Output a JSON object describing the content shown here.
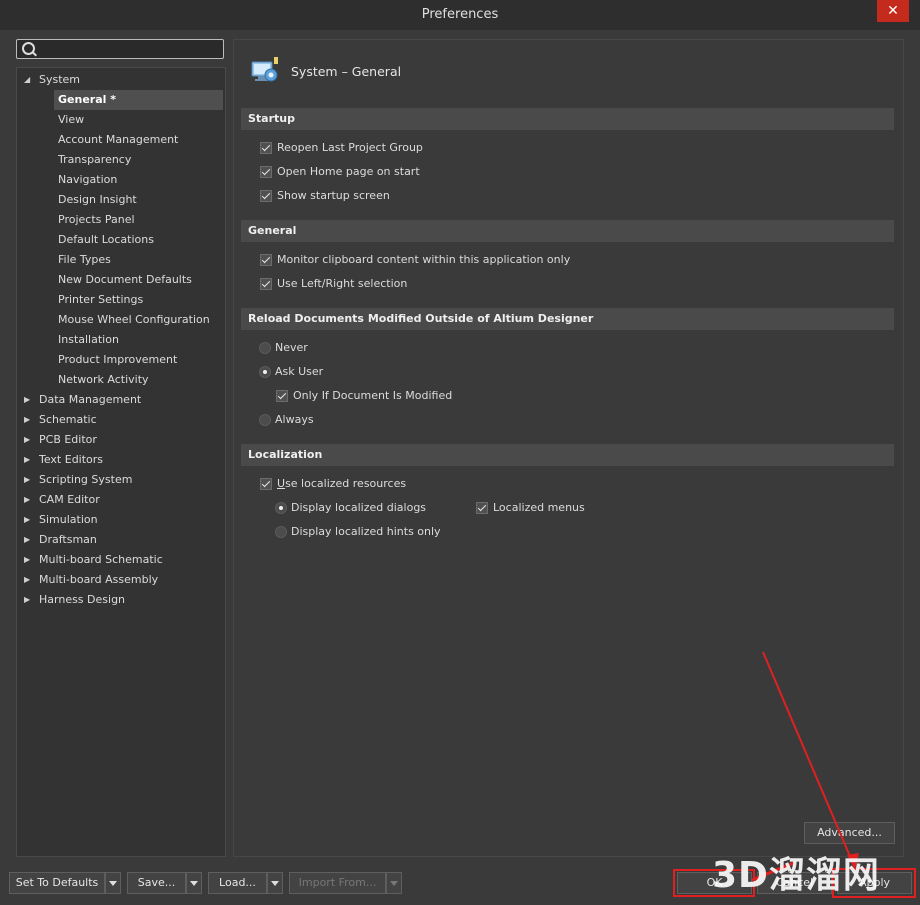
{
  "window": {
    "title": "Preferences",
    "close_icon": "close-icon"
  },
  "search": {
    "placeholder": "",
    "value": ""
  },
  "tree": {
    "system": "System",
    "system_children": [
      "General *",
      "View",
      "Account Management",
      "Transparency",
      "Navigation",
      "Design Insight",
      "Projects Panel",
      "Default Locations",
      "File Types",
      "New Document Defaults",
      "Printer Settings",
      "Mouse Wheel Configuration",
      "Installation",
      "Product Improvement",
      "Network Activity"
    ],
    "collapsed": [
      "Data Management",
      "Schematic",
      "PCB Editor",
      "Text Editors",
      "Scripting System",
      "CAM Editor",
      "Simulation",
      "Draftsman",
      "Multi-board Schematic",
      "Multi-board Assembly",
      "Harness Design"
    ]
  },
  "page": {
    "title": "System – General",
    "icon": "system-general-icon"
  },
  "startup": {
    "header": "Startup",
    "reopen": "Reopen Last Project Group",
    "home": "Open Home page on start",
    "splash": "Show startup screen"
  },
  "general": {
    "header": "General",
    "clipboard": "Monitor clipboard content within this application only",
    "leftright": "Use Left/Right selection"
  },
  "reload": {
    "header": "Reload Documents Modified Outside of Altium Designer",
    "never": "Never",
    "ask": "Ask User",
    "only_modified": "Only If Document Is Modified",
    "always": "Always"
  },
  "localization": {
    "header": "Localization",
    "use_localized_u": "U",
    "use_localized_rest": "se localized resources",
    "dialogs": "Display localized dialogs",
    "menus": "Localized menus",
    "hints": "Display localized hints only"
  },
  "buttons": {
    "advanced": "Advanced...",
    "defaults": "Set To Defaults",
    "save": "Save...",
    "load": "Load...",
    "import": "Import From...",
    "ok": "OK",
    "cancel": "Cancel",
    "apply": "Apply"
  },
  "watermark": "3D溜溜网",
  "annotation_color": "#e02020"
}
